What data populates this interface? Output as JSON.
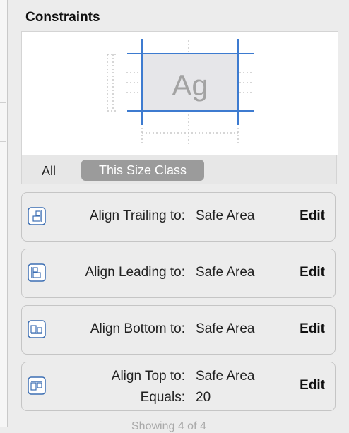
{
  "panel": {
    "title": "Constraints"
  },
  "preview": {
    "sample_text": "Ag"
  },
  "tabs": {
    "all_label": "All",
    "size_class_label": "This Size Class"
  },
  "constraints": [
    {
      "label": "Align Trailing to:",
      "value": "Safe Area",
      "edit": "Edit",
      "icon": "align-trailing-icon"
    },
    {
      "label": "Align Leading to:",
      "value": "Safe Area",
      "edit": "Edit",
      "icon": "align-leading-icon"
    },
    {
      "label": "Align Bottom to:",
      "value": "Safe Area",
      "edit": "Edit",
      "icon": "align-bottom-icon"
    },
    {
      "label": "Align Top to:",
      "value": "Safe Area",
      "label2": "Equals:",
      "value2": "20",
      "edit": "Edit",
      "icon": "align-top-icon"
    }
  ],
  "footer": {
    "status": "Showing 4 of 4"
  },
  "colors": {
    "guide_blue": "#3d7bd0",
    "card_border": "#c5c5c5",
    "selected_tab": "#9b9b9b"
  }
}
